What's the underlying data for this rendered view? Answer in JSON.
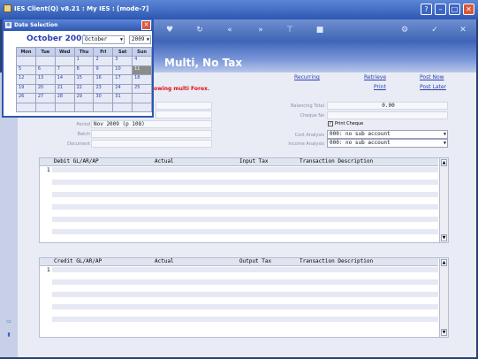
{
  "window": {
    "title": "IES Client(Q) v8.21 : My IES :      [mode-7]"
  },
  "band": {
    "heading": "Multi, No Tax"
  },
  "links": {
    "recurring": "Recurring",
    "retrieve": "Retrieve",
    "post_now": "Post Now",
    "print": "Print",
    "post_later": "Post Later"
  },
  "warning": "lowing multi Forex.",
  "left_form": {
    "period_value": "Nov 2009 (p 108)",
    "labels": {
      "period": "Period",
      "batch": "Batch",
      "document": "Document"
    }
  },
  "right_form": {
    "balancing_total_label": "Balancing Total",
    "balancing_total_value": "0.00",
    "cheque_no_label": "Cheque No",
    "print_cheque_label": "Print Cheque",
    "print_cheque_checked": "✓",
    "cost_analysis_label": "Cost Analysis",
    "cost_analysis_value": "000: no sub account",
    "income_analysis_label": "Income Analysis",
    "income_analysis_value": "000: no sub account"
  },
  "debit_grid": {
    "headers": [
      "Debit GL/AR/AP",
      "Actual",
      "Input Tax",
      "Transaction Description"
    ],
    "first_row_number": "1"
  },
  "credit_grid": {
    "headers": [
      "Credit GL/AR/AP",
      "Actual",
      "Output Tax",
      "Transaction Description"
    ],
    "first_row_number": "1"
  },
  "calendar": {
    "title": "Date Selection",
    "month_title": "October 2009",
    "month_select": "October",
    "year_select": "2009",
    "weekdays": [
      "Mon",
      "Tue",
      "Wed",
      "Thu",
      "Fri",
      "Sat",
      "Sun"
    ],
    "weeks": [
      [
        "",
        "",
        "",
        "1",
        "2",
        "3",
        "4"
      ],
      [
        "5",
        "6",
        "7",
        "8",
        "9",
        "10",
        "11"
      ],
      [
        "12",
        "13",
        "14",
        "15",
        "16",
        "17",
        "18"
      ],
      [
        "19",
        "20",
        "21",
        "22",
        "23",
        "24",
        "25"
      ],
      [
        "26",
        "27",
        "28",
        "29",
        "30",
        "31",
        ""
      ],
      [
        "",
        "",
        "",
        "",
        "",
        "",
        ""
      ]
    ],
    "today": "11"
  },
  "icons": {
    "close": "✕",
    "minimize": "–",
    "maximize": "□",
    "help": "?",
    "up": "▲",
    "down": "▼"
  }
}
